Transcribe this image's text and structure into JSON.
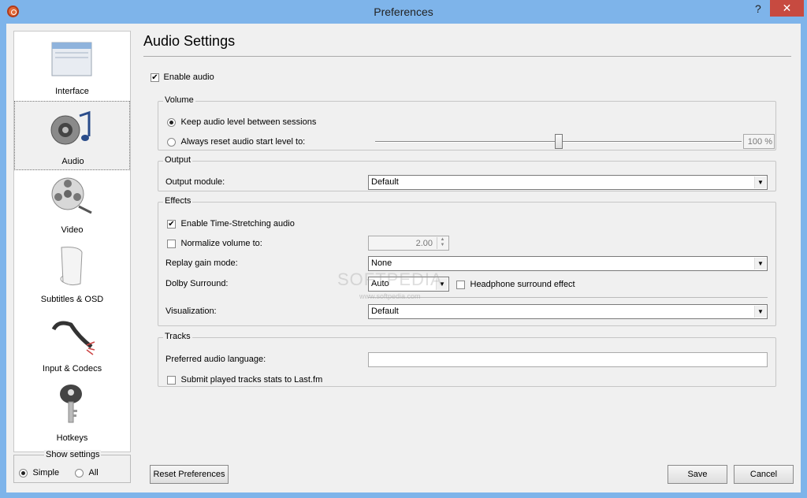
{
  "window": {
    "title": "Preferences",
    "help_label": "?",
    "close_label": "✕"
  },
  "sidebar": {
    "items": [
      {
        "label": "Interface",
        "icon": "interface-icon"
      },
      {
        "label": "Audio",
        "icon": "audio-icon",
        "selected": true
      },
      {
        "label": "Video",
        "icon": "video-icon"
      },
      {
        "label": "Subtitles & OSD",
        "icon": "subtitles-icon"
      },
      {
        "label": "Input & Codecs",
        "icon": "input-codecs-icon"
      },
      {
        "label": "Hotkeys",
        "icon": "hotkeys-icon"
      }
    ],
    "show_settings": {
      "label": "Show settings",
      "simple": "Simple",
      "all": "All",
      "selected": "Simple"
    }
  },
  "page": {
    "title": "Audio Settings",
    "enable_audio": {
      "label": "Enable audio",
      "checked": true
    },
    "volume": {
      "title": "Volume",
      "keep_level": {
        "label": "Keep audio level between sessions",
        "selected": true
      },
      "always_reset": {
        "label": "Always reset audio start level to:",
        "selected": false
      },
      "slider_value": 0.5,
      "level_text": "100 %"
    },
    "output": {
      "title": "Output",
      "module_label": "Output module:",
      "module_value": "Default"
    },
    "effects": {
      "title": "Effects",
      "time_stretch": {
        "label": "Enable Time-Stretching audio",
        "checked": true
      },
      "normalize": {
        "label": "Normalize volume to:",
        "checked": false,
        "value": "2.00"
      },
      "replay_gain": {
        "label": "Replay gain mode:",
        "value": "None"
      },
      "dolby": {
        "label": "Dolby Surround:",
        "value": "Auto"
      },
      "headphone": {
        "label": "Headphone surround effect",
        "checked": false
      },
      "visualization": {
        "label": "Visualization:",
        "value": "Default"
      }
    },
    "tracks": {
      "title": "Tracks",
      "preferred_language": {
        "label": "Preferred audio language:",
        "value": ""
      },
      "lastfm": {
        "label": "Submit played tracks stats to Last.fm",
        "checked": false
      }
    }
  },
  "buttons": {
    "reset": "Reset Preferences",
    "save": "Save",
    "cancel": "Cancel"
  },
  "watermark": {
    "text": "SOFTPEDIA",
    "sub": "www.softpedia.com"
  }
}
